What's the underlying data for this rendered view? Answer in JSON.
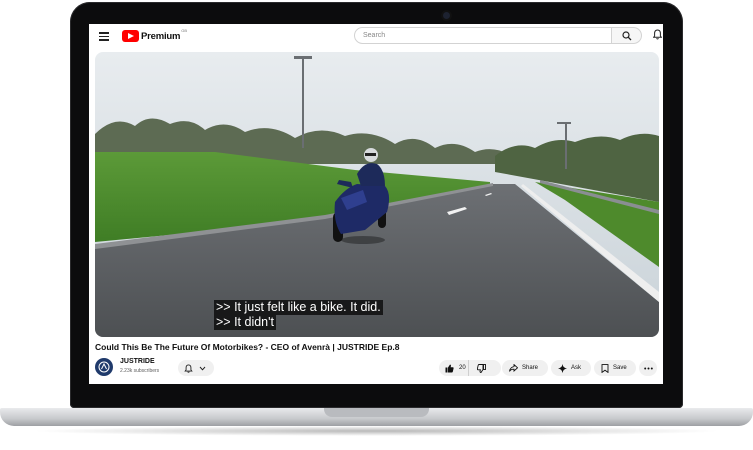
{
  "header": {
    "logo_text": "Premium",
    "logo_region": "GB",
    "search_placeholder": "Search"
  },
  "video": {
    "caption_line1": ">> It just felt like a bike. It did.",
    "caption_line2": ">> It didn't",
    "title": "Could This Be The Future Of Motorbikes? - CEO of Avenrà | JUSTRIDE Ep.8"
  },
  "channel": {
    "name": "JUSTRIDE",
    "subscribers": "2.23k subscribers"
  },
  "actions": {
    "like_count": "20",
    "share_label": "Share",
    "ask_label": "Ask",
    "save_label": "Save"
  },
  "colors": {
    "brand_red": "#ff0000",
    "pill_bg": "#f0f0f0",
    "laptop_bezel": "#0c0c0d"
  },
  "icons": [
    "menu-icon",
    "youtube-logo-icon",
    "search-icon",
    "bell-icon",
    "avatar-icon",
    "bell-subscribe-icon",
    "chevron-down-icon",
    "thumbs-up-icon",
    "thumbs-down-icon",
    "share-icon",
    "sparkle-icon",
    "save-icon",
    "more-icon"
  ]
}
